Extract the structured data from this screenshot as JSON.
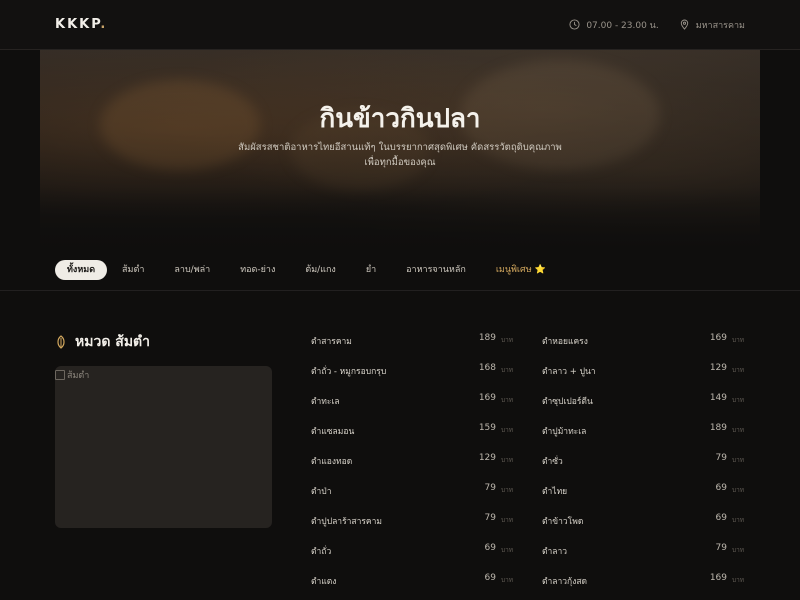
{
  "header": {
    "logo": "KKKP",
    "logo_dot": ".",
    "hours": "07.00 - 23.00 น.",
    "location": "มหาสารคาม"
  },
  "hero": {
    "title": "กินข้าวกินปลา",
    "subtitle_line1": "สัมผัสรสชาติอาหารไทยอีสานแท้ๆ ในบรรยากาศสุดพิเศษ คัดสรรวัตถุดิบคุณภาพ",
    "subtitle_line2": "เพื่อทุกมื้อของคุณ"
  },
  "categories": [
    {
      "label": "ทั้งหมด",
      "active": true
    },
    {
      "label": "ส้มตำ"
    },
    {
      "label": "ลาบ/พล่า"
    },
    {
      "label": "ทอด-ย่าง"
    },
    {
      "label": "ต้ม/แกง"
    },
    {
      "label": "ยำ"
    },
    {
      "label": "อาหารจานหลัก"
    },
    {
      "label": "เมนูพิเศษ ⭐",
      "special": true
    }
  ],
  "section": {
    "title": "หมวด ส้มตำ",
    "image_alt": "ส้มตำ",
    "icon": "leaf-icon"
  },
  "unit": "บาท",
  "menu_left": [
    {
      "name": "ตำสารคาม",
      "price": "189"
    },
    {
      "name": "ตำถั่ว - หมูกรอบกรุบ",
      "price": "168"
    },
    {
      "name": "ตำทะเล",
      "price": "169"
    },
    {
      "name": "ตำแซลมอน",
      "price": "159"
    },
    {
      "name": "ตำแองทอด",
      "price": "129"
    },
    {
      "name": "ตำป่า",
      "price": "79"
    },
    {
      "name": "ตำปูปลาร้าสารคาม",
      "price": "79"
    },
    {
      "name": "ตำถั่ว",
      "price": "69"
    },
    {
      "name": "ตำแตง",
      "price": "69"
    }
  ],
  "menu_right": [
    {
      "name": "ตำหอยแครง",
      "price": "169"
    },
    {
      "name": "ตำลาว + ปูนา",
      "price": "129"
    },
    {
      "name": "ตำซุปเปอร์ตีน",
      "price": "149"
    },
    {
      "name": "ตำปูม้าทะเล",
      "price": "189"
    },
    {
      "name": "ตำซั่ว",
      "price": "79"
    },
    {
      "name": "ตำไทย",
      "price": "69"
    },
    {
      "name": "ตำข้าวโพด",
      "price": "69"
    },
    {
      "name": "ตำลาว",
      "price": "79"
    },
    {
      "name": "ตำลาวกุ้งสด",
      "price": "169"
    }
  ],
  "colors": {
    "accent": "#d3a85e",
    "background": "#0f0e0d"
  }
}
